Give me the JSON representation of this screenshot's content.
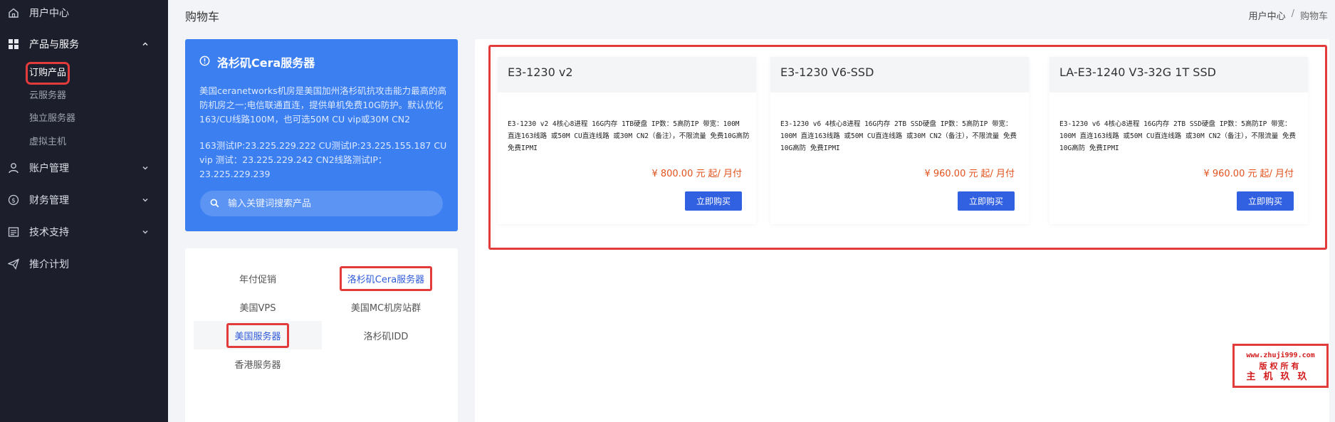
{
  "sidebar": {
    "items": [
      {
        "label": "用户中心",
        "icon": "home-icon"
      },
      {
        "label": "产品与服务",
        "icon": "grid-icon",
        "expanded": true,
        "children": [
          "订购产品",
          "云服务器",
          "独立服务器",
          "虚拟主机"
        ]
      },
      {
        "label": "账户管理",
        "icon": "user-icon"
      },
      {
        "label": "财务管理",
        "icon": "dollar-icon"
      },
      {
        "label": "技术支持",
        "icon": "ticket-icon"
      },
      {
        "label": "推介计划",
        "icon": "send-icon"
      }
    ]
  },
  "header": {
    "title": "购物车",
    "breadcrumb": [
      "用户中心",
      "/",
      "购物车"
    ]
  },
  "info_card": {
    "title": "洛杉矶Cera服务器",
    "description": "美国ceranetworks机房是美国加州洛杉矶抗攻击能力最高的高防机房之一;电信联通直连，提供单机免费10G防护。默认优化163/CU线路100M，也可选50M CU vip或30M CN2",
    "ips": "163测试IP:23.225.229.222 CU测试IP:23.225.155.187 CU vip 测试：23.225.229.242 CN2线路测试IP：23.225.229.239",
    "search_placeholder": "输入关键词搜索产品"
  },
  "categories": {
    "left": [
      "年付促销",
      "美国VPS",
      "美国服务器",
      "香港服务器"
    ],
    "right": [
      "洛杉矶Cera服务器",
      "美国MC机房站群",
      "洛杉矶IDD"
    ]
  },
  "products": [
    {
      "name": "E3-1230 v2",
      "desc": "E3-1230 v2 4核心8进程 16G内存 1TB硬盘 IP数：5高防IP 带宽：100M 直连163线路 或50M CU直连线路 或30M CN2（备注），不限流量 免费10G高防 免费IPMI",
      "price": "¥ 800.00 元",
      "unit": "起/ 月付",
      "button": "立即购买"
    },
    {
      "name": "E3-1230 V6-SSD",
      "desc": "E3-1230 v6 4核心8进程 16G内存 2TB SSD硬盘 IP数：5高防IP 带宽：100M 直连163线路 或50M CU直连线路 或30M CN2（备注），不限流量 免费10G高防 免费IPMI",
      "price": "¥ 960.00 元",
      "unit": "起/ 月付",
      "button": "立即购买"
    },
    {
      "name": "LA-E3-1240 V3-32G 1T SSD",
      "desc": "E3-1230 v6 4核心8进程 16G内存 2TB SSD硬盘 IP数：5高防IP 带宽：100M 直连163线路 或50M CU直连线路 或30M CN2（备注），不限流量 免费10G高防 免费IPMI",
      "price": "¥ 960.00 元",
      "unit": "起/ 月付",
      "button": "立即购买"
    }
  ],
  "watermark": {
    "line1": "www.zhuji999.com",
    "line2": "版权所有",
    "line3": "主机玖玖"
  },
  "colors": {
    "sidebar_bg": "#1c1e2c",
    "accent_blue": "#3c7ff0",
    "button_blue": "#3160e0",
    "price_orange": "#e2521d",
    "highlight_red": "#e23b3b"
  }
}
